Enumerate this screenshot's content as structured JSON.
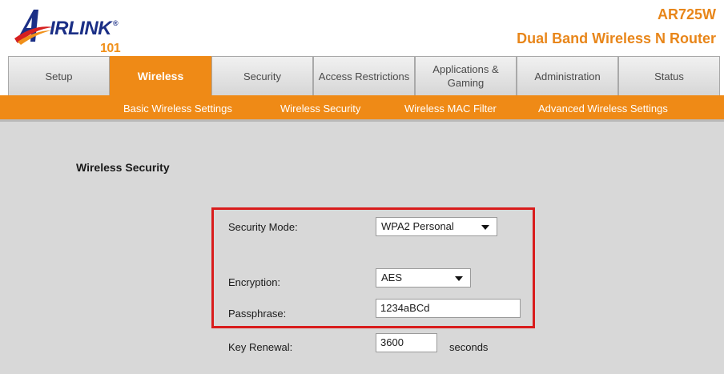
{
  "brand": {
    "logo_text": "IRLINK",
    "logo_number": "101",
    "registered": "®",
    "model": "AR725W",
    "product_name": "Dual Band Wireless N Router",
    "accent_color": "#ef8a16",
    "logo_color": "#1b2f86"
  },
  "tabs": [
    {
      "label": "Setup"
    },
    {
      "label": "Wireless",
      "active": true
    },
    {
      "label": "Security"
    },
    {
      "label": "Access Restrictions"
    },
    {
      "label": "Applications & Gaming"
    },
    {
      "label": "Administration"
    },
    {
      "label": "Status"
    }
  ],
  "subnav": [
    {
      "label": "Basic Wireless Settings"
    },
    {
      "label": "Wireless Security"
    },
    {
      "label": "Wireless MAC Filter"
    },
    {
      "label": "Advanced Wireless Settings"
    }
  ],
  "form": {
    "section_title": "Wireless Security",
    "security_mode": {
      "label": "Security Mode:",
      "value": "WPA2 Personal"
    },
    "encryption": {
      "label": "Encryption:",
      "value": "AES"
    },
    "passphrase": {
      "label": "Passphrase:",
      "value": "1234aBCd"
    },
    "key_renewal": {
      "label": "Key Renewal:",
      "value": "3600",
      "unit": "seconds"
    }
  },
  "annotation_color": "#d91c1c"
}
